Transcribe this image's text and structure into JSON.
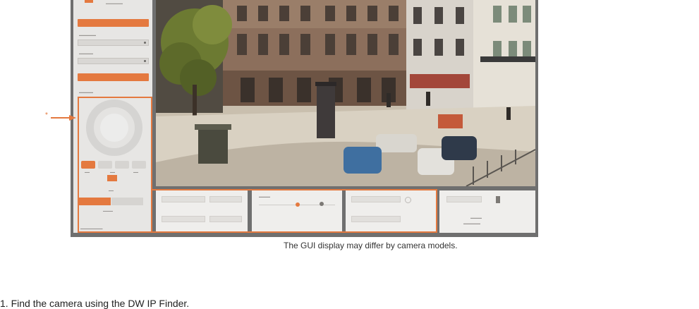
{
  "caption": "The GUI display may differ by camera models.",
  "annotation": {
    "marker": "*"
  },
  "colors": {
    "accent": "#e4793f",
    "frame": "#6f6f6f",
    "sidebar": "#e7e6e4"
  },
  "partial_line": "1.   Find the camera using the DW IP Finder."
}
